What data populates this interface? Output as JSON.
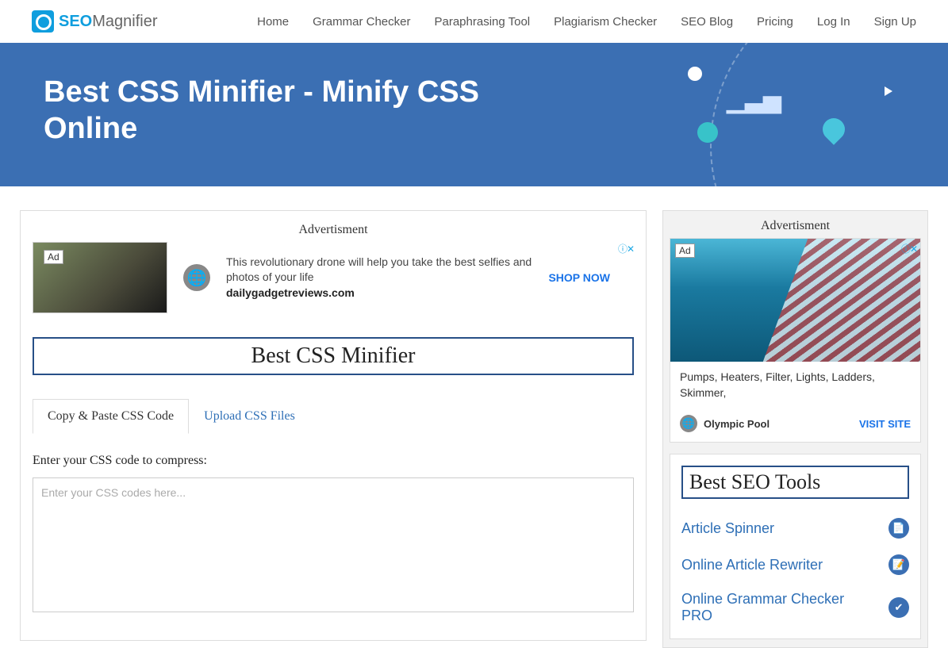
{
  "logo": {
    "part1": "SEO",
    "part2": "Magnifier"
  },
  "nav": {
    "items": [
      "Home",
      "Grammar Checker",
      "Paraphrasing Tool",
      "Plagiarism Checker",
      "SEO Blog",
      "Pricing",
      "Log In",
      "Sign Up"
    ]
  },
  "hero": {
    "title": "Best CSS Minifier - Minify CSS Online"
  },
  "main": {
    "ad_label": "Advertisment",
    "ad1": {
      "badge": "Ad",
      "text": "This revolutionary drone will help you take the best selfies and photos of your life",
      "domain": "dailygadgetreviews.com",
      "cta": "SHOP NOW"
    },
    "tool_title": "Best CSS Minifier",
    "tabs": {
      "t1": "Copy & Paste CSS Code",
      "t2": "Upload CSS Files"
    },
    "instruction": "Enter your CSS code to compress:",
    "placeholder": "Enter your CSS codes here..."
  },
  "sidebar": {
    "ad_label": "Advertisment",
    "ad2": {
      "badge": "Ad",
      "desc": "Pumps, Heaters, Filter, Lights, Ladders, Skimmer,",
      "brand": "Olympic Pool",
      "cta": "VISIT SITE"
    },
    "tools_title": "Best SEO Tools",
    "tools": [
      "Article Spinner",
      "Online Article Rewriter",
      "Online Grammar Checker PRO"
    ]
  }
}
